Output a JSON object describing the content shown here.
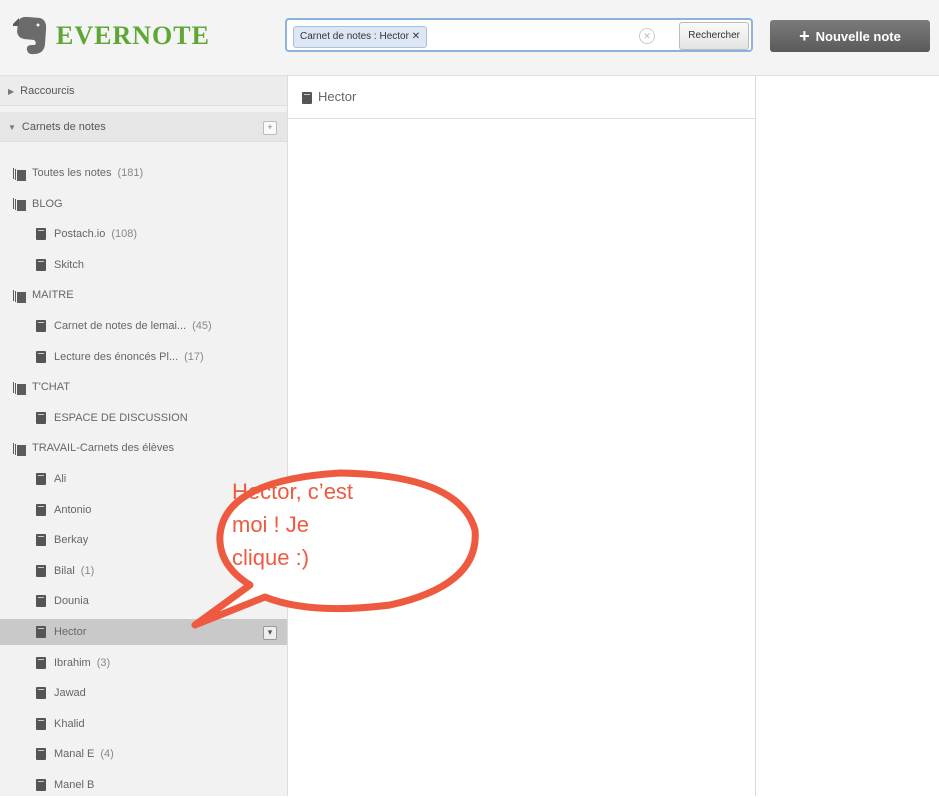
{
  "header": {
    "logo_text": "EVERNOTE",
    "search": {
      "chip": "Carnet de notes : Hector ✕",
      "clear_icon": "clear-icon",
      "button": "Rechercher"
    },
    "new_note": {
      "icon": "+",
      "label": "Nouvelle note"
    }
  },
  "sidebar": {
    "shortcuts_label": "Raccourcis",
    "notebooks_label": "Carnets de notes",
    "notebooks_plus": "+",
    "items": [
      {
        "type": "all",
        "label": "Toutes les notes",
        "count": "(181)"
      },
      {
        "type": "stack",
        "label": "BLOG",
        "count": ""
      },
      {
        "type": "notebook",
        "label": "Postach.io",
        "count": "(108)"
      },
      {
        "type": "notebook",
        "label": "Skitch",
        "count": ""
      },
      {
        "type": "stack",
        "label": "MAITRE",
        "count": ""
      },
      {
        "type": "notebook",
        "label": "Carnet de notes de lemai...",
        "count": "(45)"
      },
      {
        "type": "notebook",
        "label": "Lecture des énoncés Pl...",
        "count": "(17)"
      },
      {
        "type": "stack",
        "label": "T'CHAT",
        "count": ""
      },
      {
        "type": "notebook",
        "label": "ESPACE DE DISCUSSION",
        "count": ""
      },
      {
        "type": "stack",
        "label": "TRAVAIL-Carnets des élèves",
        "count": ""
      },
      {
        "type": "notebook",
        "label": "Ali",
        "count": ""
      },
      {
        "type": "notebook",
        "label": "Antonio",
        "count": ""
      },
      {
        "type": "notebook",
        "label": "Berkay",
        "count": ""
      },
      {
        "type": "notebook",
        "label": "Bilal",
        "count": "(1)"
      },
      {
        "type": "notebook",
        "label": "Dounia",
        "count": ""
      },
      {
        "type": "notebook",
        "label": "Hector",
        "count": "",
        "selected": true
      },
      {
        "type": "notebook",
        "label": "Ibrahim",
        "count": "(3)"
      },
      {
        "type": "notebook",
        "label": "Jawad",
        "count": ""
      },
      {
        "type": "notebook",
        "label": "Khalid",
        "count": ""
      },
      {
        "type": "notebook",
        "label": "Manal E",
        "count": "(4)"
      },
      {
        "type": "notebook",
        "label": "Manel B",
        "count": ""
      }
    ]
  },
  "notelist": {
    "title": "Hector"
  },
  "callout": {
    "line1": "Hector, c’est",
    "line2": "moi ! Je",
    "line3": "clique :)",
    "color": "#ee5a40"
  }
}
